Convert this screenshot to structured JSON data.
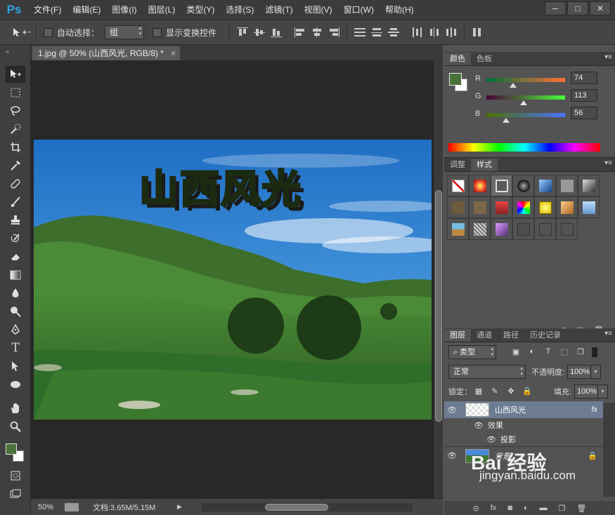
{
  "app": {
    "logo": "Ps"
  },
  "menu": [
    "文件(F)",
    "编辑(E)",
    "图像(I)",
    "图层(L)",
    "类型(Y)",
    "选择(S)",
    "滤镜(T)",
    "视图(V)",
    "窗口(W)",
    "帮助(H)"
  ],
  "window_controls": [
    "─",
    "□",
    "✕"
  ],
  "options": {
    "auto_select_label": "自动选择：",
    "auto_select_value": "组",
    "show_transform_label": "显示变换控件"
  },
  "document": {
    "tab_title": "1.jpg @ 50% (山西风光, RGB/8) *",
    "tab_close": "×",
    "title_art": "山西风光"
  },
  "status": {
    "zoom": "50%",
    "doc_size": "文档:3.65M/5.15M"
  },
  "color_panel": {
    "tabs": [
      "颜色",
      "色板"
    ],
    "r_label": "R",
    "r_value": "74",
    "g_label": "G",
    "g_value": "113",
    "b_label": "B",
    "b_value": "56",
    "fg_color": "#4a7138"
  },
  "styles_panel": {
    "tabs": [
      "调整",
      "样式"
    ]
  },
  "layers_panel": {
    "tabs": [
      "图层",
      "通道",
      "路径",
      "历史记录"
    ],
    "filter_label": "类型",
    "blend_mode": "正常",
    "opacity_label": "不透明度:",
    "opacity_value": "100%",
    "lock_label": "锁定：",
    "fill_label": "填充:",
    "fill_value": "100%",
    "layers": [
      {
        "name": "山西风光",
        "fx": "fx"
      },
      {
        "name": "效果"
      },
      {
        "name": "投影"
      },
      {
        "name": "背景"
      }
    ]
  },
  "watermark": {
    "main": "Bai 经验",
    "sub": "jingyan.baidu.com"
  }
}
